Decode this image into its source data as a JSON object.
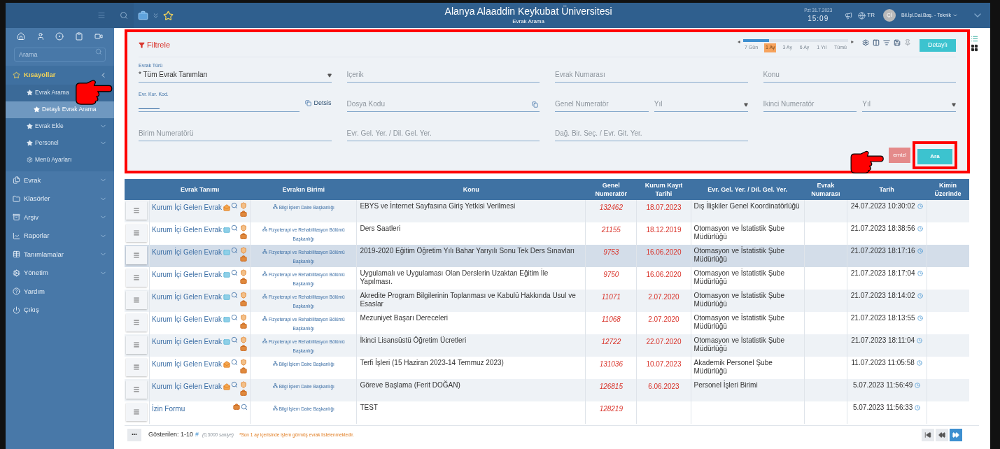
{
  "topbar": {
    "title": "Alanya Alaaddin Keykubat Üniversitesi",
    "subtitle": "Evrak Arama",
    "date": "Pzt 31.7.2023",
    "time": "15:09",
    "language": "TR",
    "avatar": "Çİ",
    "user": "Bil.İşl.Dai.Baş. - Teknik"
  },
  "sidebar": {
    "search_placeholder": "Arama",
    "menu": [
      {
        "label": "Kısayollar",
        "kind": "group",
        "expanded": true,
        "children": [
          {
            "label": "Evrak Arama",
            "kind": "group",
            "selected": false,
            "children": [
              {
                "label": "Detaylı Evrak Arama",
                "kind": "item",
                "selected": true
              }
            ]
          },
          {
            "label": "Evrak Ekle",
            "kind": "group",
            "selected": false
          },
          {
            "label": "Personel",
            "kind": "group",
            "selected": false
          },
          {
            "label": "Menü Ayarları",
            "kind": "settings",
            "selected": false
          }
        ]
      },
      {
        "label": "Evrak",
        "kind": "group",
        "expanded": false
      },
      {
        "label": "Klasörler",
        "kind": "group",
        "expanded": false
      },
      {
        "label": "Arşiv",
        "kind": "group",
        "expanded": false
      },
      {
        "label": "Raporlar",
        "kind": "group",
        "expanded": false
      },
      {
        "label": "Tanımlamalar",
        "kind": "group",
        "expanded": false
      },
      {
        "label": "Yönetim",
        "kind": "group",
        "expanded": false
      },
      {
        "label": "Yardım",
        "kind": "link"
      },
      {
        "label": "Çıkış",
        "kind": "link"
      }
    ]
  },
  "filter": {
    "title": "Filtrele",
    "period": {
      "level": 0.25,
      "options": [
        {
          "label": "7 Gün",
          "selected": false
        },
        {
          "label": "1 Ay",
          "selected": true
        },
        {
          "label": "3 Ay",
          "selected": false
        },
        {
          "label": "6 Ay",
          "selected": false
        },
        {
          "label": "1 Yıl",
          "selected": false
        },
        {
          "label": "Tümü",
          "selected": false
        }
      ]
    },
    "detail_button": "Detaylı",
    "rows": [
      [
        [
          {
            "kind": "select",
            "label": "Evrak Türü",
            "value": "* Tüm Evrak Tanımları"
          }
        ],
        [
          {
            "kind": "text",
            "placeholder": "İçerik"
          }
        ],
        [
          {
            "kind": "text",
            "placeholder": "Evrak Numarası"
          }
        ],
        [
          {
            "kind": "text",
            "placeholder": "Konu"
          }
        ]
      ],
      [
        [
          {
            "kind": "code",
            "label": "Evr. Kur. Kod."
          },
          {
            "kind": "link",
            "label": "Detsis"
          }
        ],
        [
          {
            "kind": "lookup",
            "placeholder": "Dosya Kodu"
          }
        ],
        [
          {
            "kind": "text",
            "placeholder": "Genel Numeratör"
          },
          {
            "kind": "select",
            "placeholder": "Yıl"
          }
        ],
        [
          {
            "kind": "text",
            "placeholder": "İkinci Numeratör"
          },
          {
            "kind": "select",
            "placeholder": "Yıl"
          }
        ]
      ],
      [
        [
          {
            "kind": "text",
            "placeholder": "Birim Numeratörü"
          }
        ],
        [
          {
            "kind": "text",
            "placeholder": "Evr. Gel. Yer. / Dil. Gel. Yer."
          }
        ],
        [
          {
            "kind": "text",
            "placeholder": "Dağ. Bir. Seç. / Evr. Git. Yer."
          }
        ]
      ]
    ],
    "buttons": [
      {
        "kind": "clear",
        "label": "emizl"
      },
      {
        "kind": "search",
        "label": "Ara"
      }
    ]
  },
  "table": {
    "columns": [
      "Evrak Tanımı",
      "Evrakın Birimi",
      "Konu",
      "Genel Numeratör",
      "Kurum Kayıt Tarihi",
      "Evr. Gel. Yer. / Dil. Gel. Yer.",
      "Evrak Numarası",
      "Tarih",
      "Kimin Üzerinde"
    ],
    "rows": [
      {
        "kind": "incoming",
        "selected": false,
        "name": "Kurum İçi Gelen Evrak",
        "unread": true,
        "unit": "Bilgi İşlem Daire Başkanlığı",
        "subject": "EBYS ve İnternet Sayfasına Giriş Yetkisi Verilmesi",
        "number": "132462",
        "registered": "18.07.2023",
        "origin": "Dış İlişkiler Genel Koordinatörlüğü",
        "date": "24.07.2023 10:30:02"
      },
      {
        "kind": "incoming",
        "selected": false,
        "name": "Kurum İçi Gelen Evrak",
        "unread": false,
        "unit": "Fizyoterapi ve Rehabilitasyon Bölümü Başkanlığı",
        "subject": "Ders Saatleri",
        "number": "21155",
        "registered": "18.12.2019",
        "origin": "Otomasyon ve İstatistik Şube Müdürlüğü",
        "date": "21.07.2023 18:38:56"
      },
      {
        "kind": "incoming",
        "selected": true,
        "name": "Kurum İçi Gelen Evrak",
        "unread": false,
        "unit": "Fizyoterapi ve Rehabilitasyon Bölümü Başkanlığı",
        "subject": "2019-2020 Eğitim Öğretim Yılı Bahar Yarıyılı Sonu Tek Ders Sınavları",
        "number": "9753",
        "registered": "16.06.2020",
        "origin": "Otomasyon ve İstatistik Şube Müdürlüğü",
        "date": "21.07.2023 18:17:16"
      },
      {
        "kind": "incoming",
        "selected": false,
        "name": "Kurum İçi Gelen Evrak",
        "unread": false,
        "unit": "Fizyoterapi ve Rehabilitasyon Bölümü Başkanlığı",
        "subject": "Uygulamalı ve Uygulaması Olan Derslerin Uzaktan Eğitim İle Yapılması.",
        "number": "9750",
        "registered": "16.06.2020",
        "origin": "Otomasyon ve İstatistik Şube Müdürlüğü",
        "date": "21.07.2023 18:17:04"
      },
      {
        "kind": "incoming",
        "selected": false,
        "name": "Kurum İçi Gelen Evrak",
        "unread": false,
        "unit": "Fizyoterapi ve Rehabilitasyon Bölümü Başkanlığı",
        "subject": "Akredite Program Bilgilerinin Toplanması ve Kabulü Hakkında Usul ve Esaslar",
        "number": "11071",
        "registered": "2.07.2020",
        "origin": "Otomasyon ve İstatistik Şube Müdürlüğü",
        "date": "21.07.2023 18:14:02"
      },
      {
        "kind": "incoming",
        "selected": false,
        "name": "Kurum İçi Gelen Evrak",
        "unread": false,
        "unit": "Fizyoterapi ve Rehabilitasyon Bölümü Başkanlığı",
        "subject": "Mezuniyet Başarı Dereceleri",
        "number": "11068",
        "registered": "2.07.2020",
        "origin": "Otomasyon ve İstatistik Şube Müdürlüğü",
        "date": "21.07.2023 18:13:55"
      },
      {
        "kind": "incoming",
        "selected": false,
        "name": "Kurum İçi Gelen Evrak",
        "unread": false,
        "unit": "Fizyoterapi ve Rehabilitasyon Bölümü Başkanlığı",
        "subject": "İkinci Lisansüstü Öğretim Ücretleri",
        "number": "12722",
        "registered": "22.07.2020",
        "origin": "Otomasyon ve İstatistik Şube Müdürlüğü",
        "date": "21.07.2023 18:11:04"
      },
      {
        "kind": "incoming",
        "selected": false,
        "name": "Kurum İçi Gelen Evrak",
        "unread": true,
        "unit": "Bilgi İşlem Daire Başkanlığı",
        "subject": "Terfi İşleri (15 Haziran 2023-14 Temmuz 2023)",
        "number": "131036",
        "registered": "10.07.2023",
        "origin": "Akademik Personel Şube Müdürlüğü",
        "date": "11.07.2023 11:05:58"
      },
      {
        "kind": "incoming",
        "selected": false,
        "name": "Kurum İçi Gelen Evrak",
        "unread": true,
        "unit": "Bilgi İşlem Daire Başkanlığı",
        "subject": "Göreve Başlama (Ferit DOĞAN)",
        "number": "126815",
        "registered": "6.06.2023",
        "origin": "Personel İşleri Birimi",
        "date": "5.07.2023 11:56:49"
      },
      {
        "kind": "form",
        "selected": false,
        "name": "İzin Formu",
        "unit": "Bilgi İşlem Daire Başkanlığı",
        "subject": "TEST",
        "number": "128219",
        "date": "5.07.2023 11:56:33"
      }
    ]
  },
  "footer": {
    "more": "•••",
    "shown": "Gösterilen: 1-10",
    "hash": "#",
    "duration": "(0,5000 saniye)",
    "note": "*Son 1 ay içerisinde işlem görmüş evrak listelenmektedir.",
    "pager": [
      {
        "kind": "first",
        "highlighted": false
      },
      {
        "kind": "previous",
        "highlighted": false
      },
      {
        "kind": "next",
        "highlighted": true
      }
    ]
  }
}
